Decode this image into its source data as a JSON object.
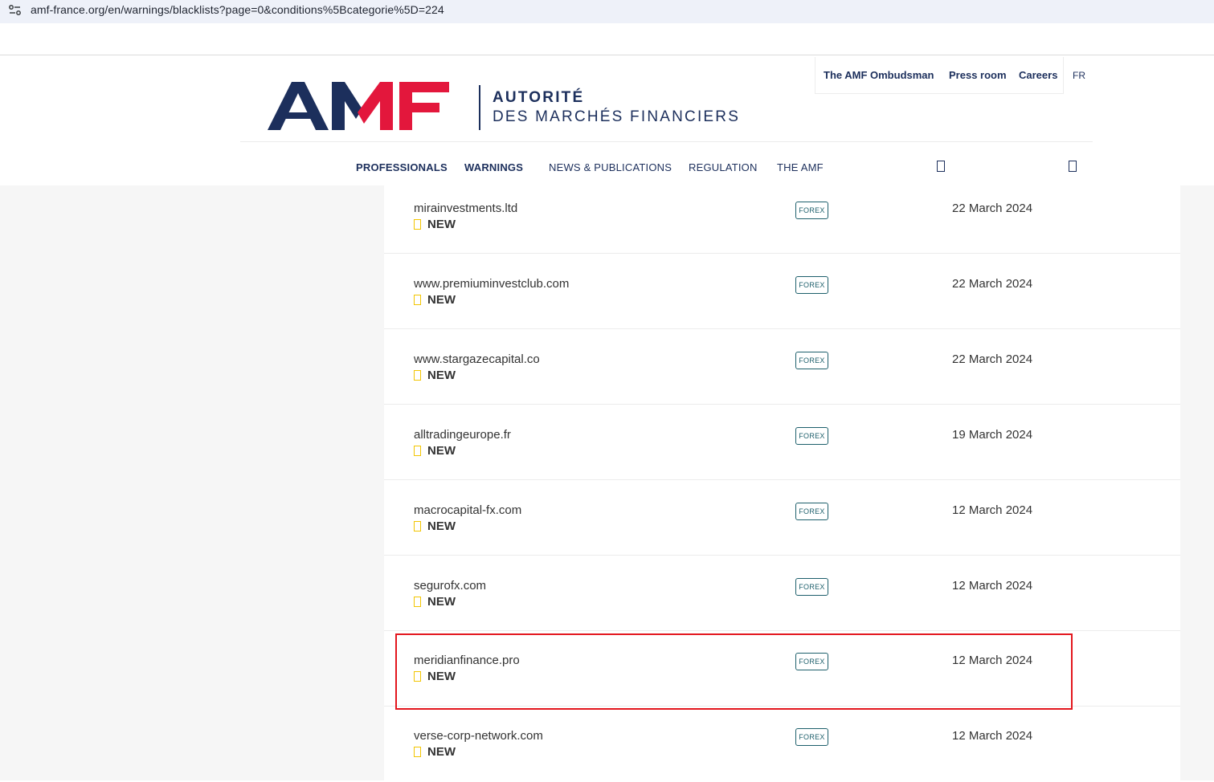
{
  "browser": {
    "url": "amf-france.org/en/warnings/blacklists?page=0&conditions%5Bcategorie%5D=224"
  },
  "header": {
    "logo_letters": "AMF",
    "logo_line1": "AUTORITÉ",
    "logo_line2": "DES MARCHÉS FINANCIERS",
    "top_links": [
      "The AMF Ombudsman",
      "Press room",
      "Careers"
    ],
    "language": "FR",
    "nav": [
      "PROFESSIONALS",
      "WARNINGS",
      "NEWS & PUBLICATIONS",
      "REGULATION",
      "THE AMF"
    ]
  },
  "colors": {
    "brand_navy": "#1c2f5c",
    "brand_red": "#e3173c",
    "tag_teal": "#1d5f6b",
    "new_yellow": "#f2c500",
    "highlight_red": "#e3161d"
  },
  "rows": [
    {
      "name": "mirainvestments.ltd",
      "badge": "NEW",
      "tag": "FOREX",
      "date": "22 March 2024"
    },
    {
      "name": "www.premiuminvestclub.com",
      "badge": "NEW",
      "tag": "FOREX",
      "date": "22 March 2024"
    },
    {
      "name": "www.stargazecapital.co",
      "badge": "NEW",
      "tag": "FOREX",
      "date": "22 March 2024"
    },
    {
      "name": "alltradingeurope.fr",
      "badge": "NEW",
      "tag": "FOREX",
      "date": "19 March 2024"
    },
    {
      "name": "macrocapital-fx.com",
      "badge": "NEW",
      "tag": "FOREX",
      "date": "12 March 2024"
    },
    {
      "name": "segurofx.com",
      "badge": "NEW",
      "tag": "FOREX",
      "date": "12 March 2024"
    },
    {
      "name": "meridianfinance.pro",
      "badge": "NEW",
      "tag": "FOREX",
      "date": "12 March 2024"
    },
    {
      "name": "verse-corp-network.com",
      "badge": "NEW",
      "tag": "FOREX",
      "date": "12 March 2024"
    }
  ]
}
